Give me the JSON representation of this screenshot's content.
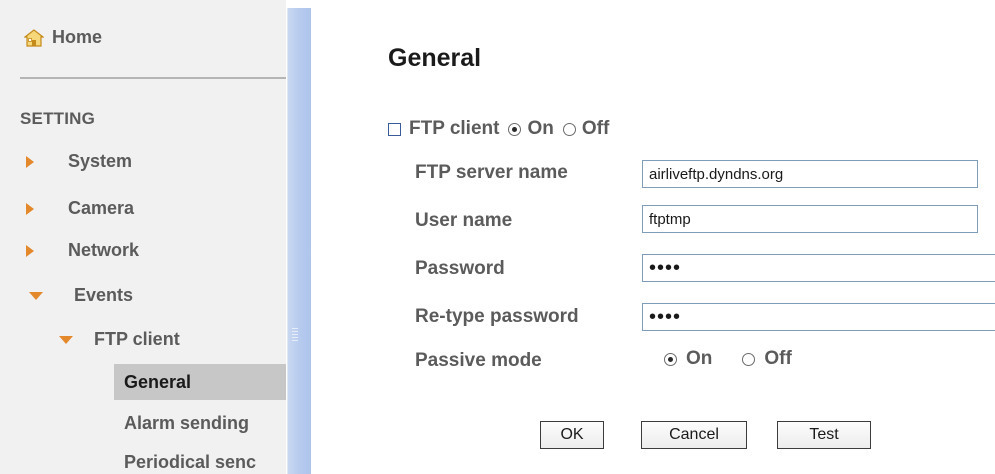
{
  "sidebar": {
    "home_label": "Home",
    "section_label": "SETTING",
    "items": [
      {
        "label": "System"
      },
      {
        "label": "Camera"
      },
      {
        "label": "Network"
      },
      {
        "label": "Events"
      }
    ],
    "ftp_client_label": "FTP client",
    "sub_items": [
      {
        "label": "General"
      },
      {
        "label": "Alarm sending"
      },
      {
        "label": "Periodical senс"
      }
    ]
  },
  "main": {
    "title": "General",
    "ftp_client": {
      "label": "FTP client",
      "on_label": "On",
      "off_label": "Off",
      "selected": "On"
    },
    "fields": {
      "server_name_label": "FTP server name",
      "server_name_value": "airliveftp.dyndns.org",
      "user_name_label": "User name",
      "user_name_value": "ftptmp",
      "password_label": "Password",
      "password_value": "••••",
      "retype_label": "Re-type password",
      "retype_value": "••••",
      "passive_label": "Passive mode",
      "passive_on": "On",
      "passive_off": "Off",
      "passive_selected": "On"
    },
    "buttons": {
      "ok": "OK",
      "cancel": "Cancel",
      "test": "Test"
    }
  },
  "colors": {
    "arrow": "#e3892b",
    "sidebar_bg": "#f1f1f1",
    "active_bg": "#c7c7c7",
    "splitter": "#b7cbef"
  }
}
